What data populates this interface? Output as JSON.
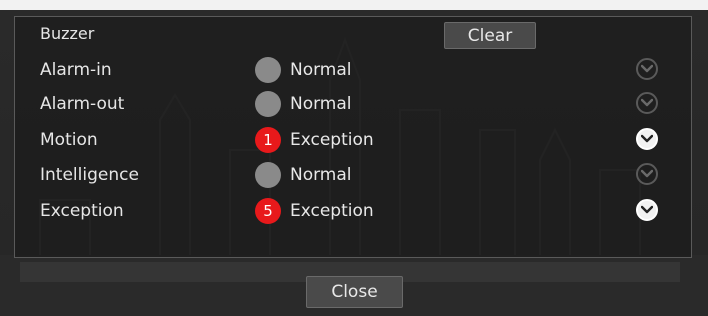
{
  "dialog": {
    "buzzer_label": "Buzzer",
    "clear_label": "Clear",
    "close_label": "Close"
  },
  "rows": [
    {
      "label": "Alarm-in",
      "count": "",
      "status": "Normal",
      "state": "normal",
      "expander": "chevron-down-icon"
    },
    {
      "label": "Alarm-out",
      "count": "",
      "status": "Normal",
      "state": "normal",
      "expander": "chevron-down-icon"
    },
    {
      "label": "Motion",
      "count": "1",
      "status": "Exception",
      "state": "exception",
      "expander": "chevron-down-icon"
    },
    {
      "label": "Intelligence",
      "count": "",
      "status": "Normal",
      "state": "normal",
      "expander": "chevron-down-icon"
    },
    {
      "label": "Exception",
      "count": "5",
      "status": "Exception",
      "state": "exception",
      "expander": "chevron-down-icon"
    }
  ],
  "colors": {
    "normal_dot": "#8a8a8a",
    "exception_dot": "#e8191b",
    "panel_bg": "#1c1c1c",
    "button_bg": "#4a4a4a"
  }
}
